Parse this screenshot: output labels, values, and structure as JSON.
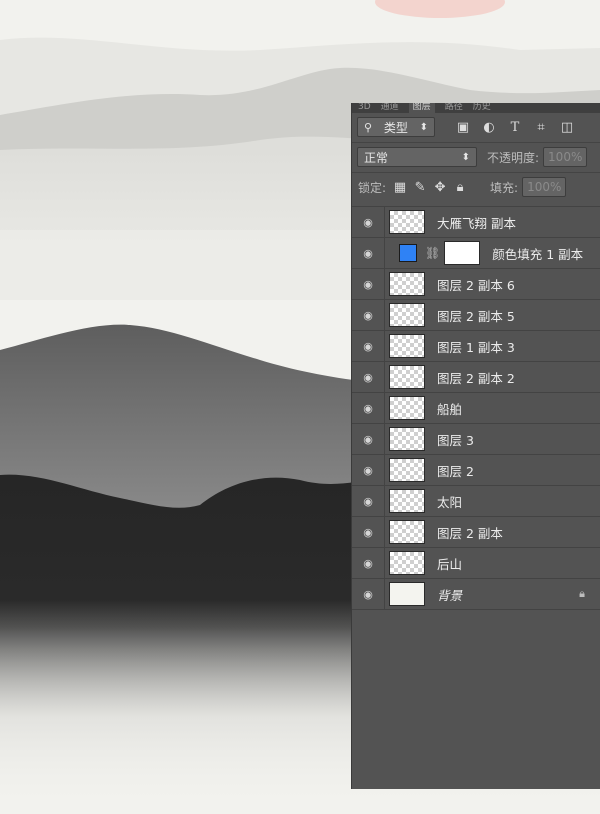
{
  "panel": {
    "tabs": [
      "3D",
      "通道",
      "图层",
      "路径",
      "历史"
    ],
    "active_tab_index": 2,
    "filter": {
      "label": "类型",
      "arrows": "⬍"
    },
    "filter_tools": [
      "image-filter-icon",
      "adjustment-filter-icon",
      "type-filter-icon",
      "shape-filter-icon",
      "smart-object-filter-icon"
    ],
    "blend_mode": "正常",
    "opacity_label": "不透明度:",
    "opacity_value": "100%",
    "lock_label": "锁定:",
    "fill_label": "填充:",
    "fill_value": "100%",
    "layers": [
      {
        "name": "大雁飞翔 副本",
        "type": "pixel"
      },
      {
        "name": "颜色填充 1 副本",
        "type": "fill"
      },
      {
        "name": "图层 2 副本 6",
        "type": "pixel"
      },
      {
        "name": "图层 2 副本 5",
        "type": "pixel"
      },
      {
        "name": "图层 1 副本 3",
        "type": "pixel"
      },
      {
        "name": "图层 2 副本 2",
        "type": "pixel"
      },
      {
        "name": "船舶",
        "type": "pixel"
      },
      {
        "name": "图层 3",
        "type": "pixel"
      },
      {
        "name": "图层 2",
        "type": "pixel"
      },
      {
        "name": "太阳",
        "type": "pixel"
      },
      {
        "name": "图层 2 副本",
        "type": "pixel"
      },
      {
        "name": "后山",
        "type": "pixel"
      },
      {
        "name": "背景",
        "type": "background",
        "locked": true
      }
    ]
  },
  "colors": {
    "panel_bg": "#535353",
    "fill_swatch": "#2f82f5",
    "canvas_bg": "#f2f2ee"
  }
}
